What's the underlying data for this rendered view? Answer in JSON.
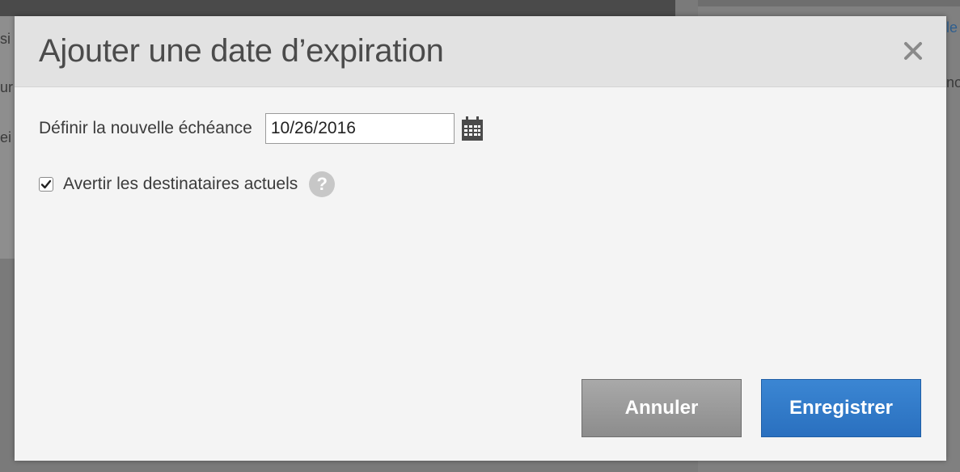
{
  "background": {
    "fragments": [
      "si",
      "ur",
      "ei",
      "le",
      "no"
    ]
  },
  "modal": {
    "title": "Ajouter une date d’expiration",
    "close_icon": "close-icon",
    "deadline": {
      "label": "Définir la nouvelle échéance",
      "value": "10/26/2016",
      "calendar_icon": "calendar-icon"
    },
    "notify": {
      "label": "Avertir les destinataires actuels",
      "checked": true,
      "help_text": "?"
    },
    "buttons": {
      "cancel": "Annuler",
      "save": "Enregistrer"
    }
  },
  "colors": {
    "primary": "#2d74c4",
    "secondary": "#999999"
  }
}
